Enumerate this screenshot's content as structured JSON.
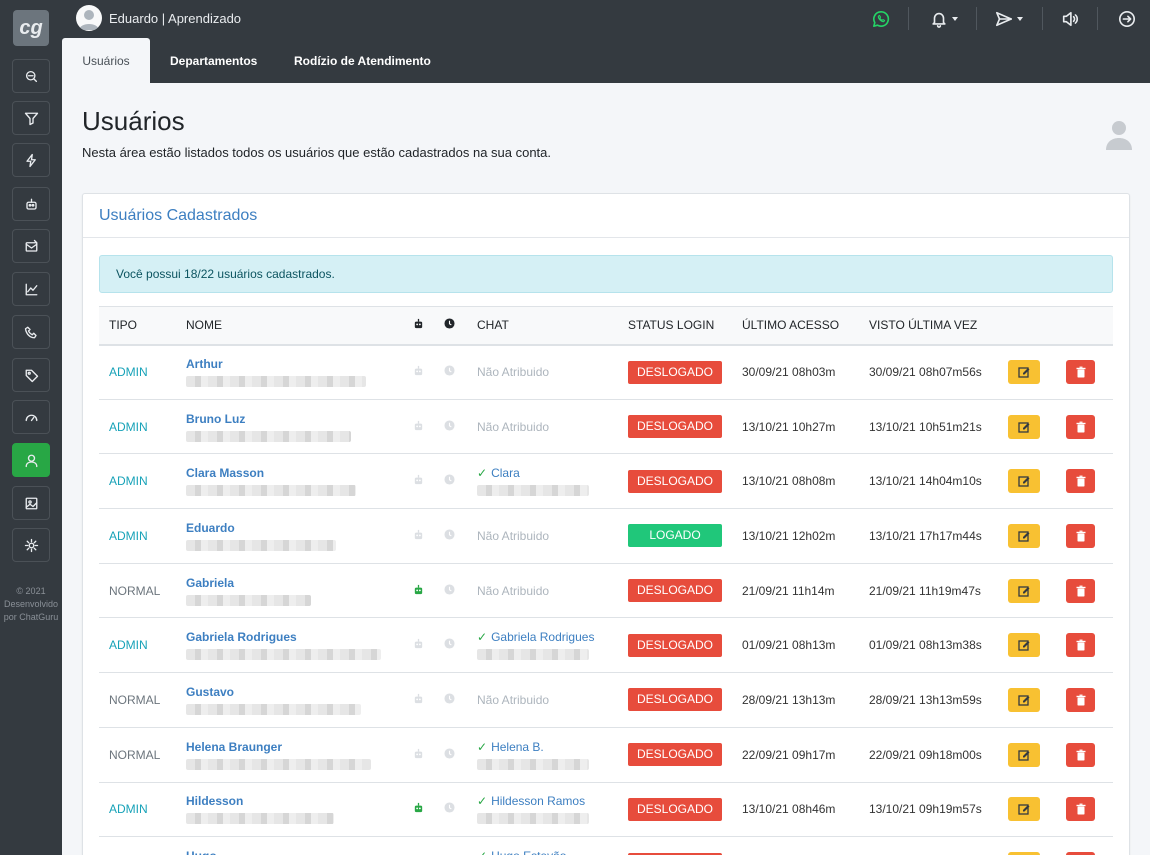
{
  "app": {
    "logo_text": "cg"
  },
  "sidebar": {
    "items": [
      {
        "name": "conversations-icon"
      },
      {
        "name": "funnel-icon"
      },
      {
        "name": "bolt-icon"
      },
      {
        "name": "robot-icon"
      },
      {
        "name": "campaign-icon"
      },
      {
        "name": "chart-icon"
      },
      {
        "name": "phone-icon"
      },
      {
        "name": "tag-icon"
      },
      {
        "name": "gauge-icon"
      },
      {
        "name": "user-icon",
        "active": true
      },
      {
        "name": "image-icon"
      },
      {
        "name": "gear-icon"
      }
    ],
    "footer_lines": [
      "© 2021",
      "Desenvolvido",
      "por ChatGuru"
    ]
  },
  "topbar": {
    "user_label": "Eduardo | Aprendizado",
    "icons": [
      "whatsapp-icon",
      "bell-icon",
      "send-icon",
      "volume-icon",
      "logout-icon"
    ]
  },
  "tabs": [
    {
      "label": "Usuários",
      "active": true
    },
    {
      "label": "Departamentos"
    },
    {
      "label": "Rodízio de Atendimento"
    }
  ],
  "page": {
    "title": "Usuários",
    "subtitle": "Nesta área estão listados todos os usuários que estão cadastrados na sua conta."
  },
  "card": {
    "title": "Usuários Cadastrados",
    "alert": "Você possui 18/22 usuários cadastrados."
  },
  "table": {
    "headers": {
      "tipo": "TIPO",
      "nome": "NOME",
      "chat": "CHAT",
      "status": "STATUS LOGIN",
      "ultimo": "ÚLTIMO ACESSO",
      "visto": "VISTO ÚLTIMA VEZ"
    },
    "rows": [
      {
        "tipo": "ADMIN",
        "nome": "Arthur",
        "bot": false,
        "chat": "Não Atribuido",
        "chat_set": false,
        "status": "DESLOGADO",
        "ultimo": "30/09/21 08h03m",
        "visto": "30/09/21 08h07m56s"
      },
      {
        "tipo": "ADMIN",
        "nome": "Bruno Luz",
        "bot": false,
        "chat": "Não Atribuido",
        "chat_set": false,
        "status": "DESLOGADO",
        "ultimo": "13/10/21 10h27m",
        "visto": "13/10/21 10h51m21s"
      },
      {
        "tipo": "ADMIN",
        "nome": "Clara Masson",
        "bot": false,
        "chat": "Clara",
        "chat_set": true,
        "status": "DESLOGADO",
        "ultimo": "13/10/21 08h08m",
        "visto": "13/10/21 14h04m10s"
      },
      {
        "tipo": "ADMIN",
        "nome": "Eduardo",
        "bot": false,
        "chat": "Não Atribuido",
        "chat_set": false,
        "status": "LOGADO",
        "ultimo": "13/10/21 12h02m",
        "visto": "13/10/21 17h17m44s"
      },
      {
        "tipo": "NORMAL",
        "nome": "Gabriela",
        "bot": true,
        "chat": "Não Atribuido",
        "chat_set": false,
        "status": "DESLOGADO",
        "ultimo": "21/09/21 11h14m",
        "visto": "21/09/21 11h19m47s"
      },
      {
        "tipo": "ADMIN",
        "nome": "Gabriela Rodrigues",
        "bot": false,
        "chat": "Gabriela Rodrigues",
        "chat_set": true,
        "status": "DESLOGADO",
        "ultimo": "01/09/21 08h13m",
        "visto": "01/09/21 08h13m38s"
      },
      {
        "tipo": "NORMAL",
        "nome": "Gustavo",
        "bot": false,
        "chat": "Não Atribuido",
        "chat_set": false,
        "status": "DESLOGADO",
        "ultimo": "28/09/21 13h13m",
        "visto": "28/09/21 13h13m59s"
      },
      {
        "tipo": "NORMAL",
        "nome": "Helena Braunger",
        "bot": false,
        "chat": "Helena B.",
        "chat_set": true,
        "status": "DESLOGADO",
        "ultimo": "22/09/21 09h17m",
        "visto": "22/09/21 09h18m00s"
      },
      {
        "tipo": "ADMIN",
        "nome": "Hildesson",
        "bot": true,
        "chat": "Hildesson Ramos",
        "chat_set": true,
        "status": "DESLOGADO",
        "ultimo": "13/10/21 08h46m",
        "visto": "13/10/21 09h19m57s"
      },
      {
        "tipo": "ADMIN",
        "nome": "Hugo",
        "bot": false,
        "chat": "Hugo Estevão",
        "chat_set": true,
        "status": "DESLOGADO",
        "ultimo": "",
        "visto": ""
      }
    ]
  }
}
